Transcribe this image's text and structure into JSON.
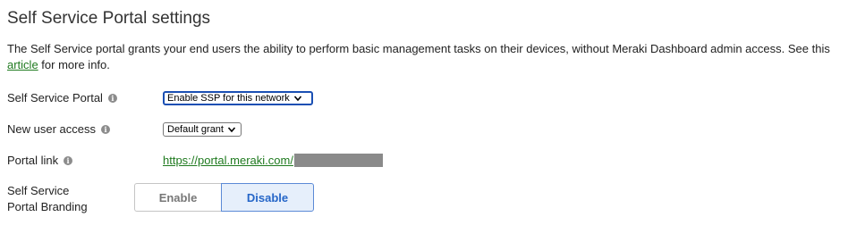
{
  "page": {
    "title": "Self Service Portal settings",
    "description_before_link": "The Self Service portal grants your end users the ability to perform basic management tasks on their devices, without Meraki Dashboard admin access. See this ",
    "description_link": "article",
    "description_after_link": " for more info."
  },
  "settings": {
    "ssp": {
      "label": "Self Service Portal",
      "selected": "Enable SSP for this network"
    },
    "new_user_access": {
      "label": "New user access",
      "selected": "Default grant"
    },
    "portal_link": {
      "label": "Portal link",
      "url": "https://portal.meraki.com/"
    },
    "branding": {
      "label_line1": "Self Service",
      "label_line2": "Portal Branding",
      "enable_label": "Enable",
      "disable_label": "Disable",
      "active": "Disable"
    }
  },
  "icons": {
    "info": "info-icon",
    "dropdown": "chevron-down-icon"
  },
  "colors": {
    "link": "#1f7a1f",
    "active_toggle_text": "#2566c8",
    "active_toggle_bg": "#e6effb",
    "focus_border": "#1a4fb3"
  }
}
